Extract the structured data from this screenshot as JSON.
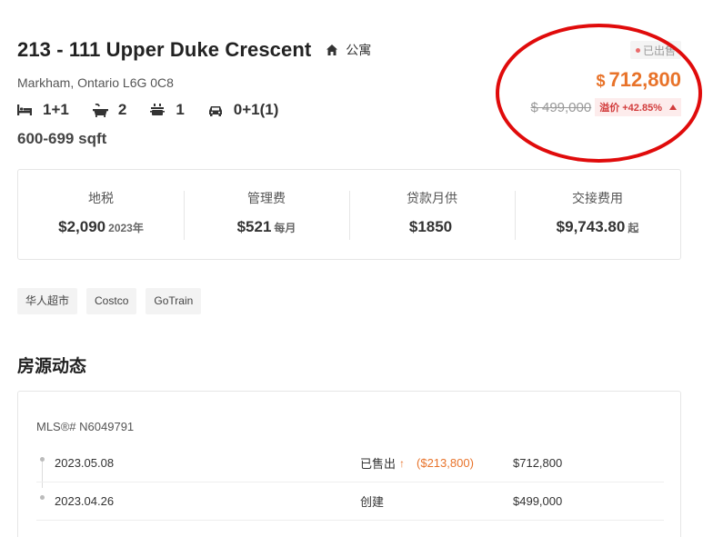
{
  "listing": {
    "title": "213 - 111 Upper Duke Crescent",
    "property_type": "公寓",
    "address": "Markham, Ontario L6G 0C8",
    "bedrooms": "1+1",
    "bathrooms": "2",
    "kitchens": "1",
    "parking": "0+1(1)",
    "sqft": "600-699 sqft"
  },
  "price": {
    "status": "已出售",
    "currency": "$",
    "sold_price": "712,800",
    "original_price": "$ 499,000",
    "premium_label": "溢价 +42.85%"
  },
  "costs": [
    {
      "label": "地税",
      "value": "$2,090",
      "unit": "2023年"
    },
    {
      "label": "管理费",
      "value": "$521",
      "unit": "每月"
    },
    {
      "label": "贷款月供",
      "value": "$1850",
      "unit": ""
    },
    {
      "label": "交接费用",
      "value": "$9,743.80",
      "unit": "起"
    }
  ],
  "tags": [
    "华人超市",
    "Costco",
    "GoTrain"
  ],
  "history": {
    "section_title": "房源动态",
    "mls": "MLS®# N6049791",
    "rows": [
      {
        "date": "2023.05.08",
        "status": "已售出",
        "change": "($213,800)",
        "price": "$712,800"
      },
      {
        "date": "2023.04.26",
        "status": "创建",
        "change": "",
        "price": "$499,000"
      }
    ]
  },
  "colors": {
    "accent": "#e8732a",
    "premium": "#d23c3c",
    "annotation_circle": "#e00b0b"
  }
}
